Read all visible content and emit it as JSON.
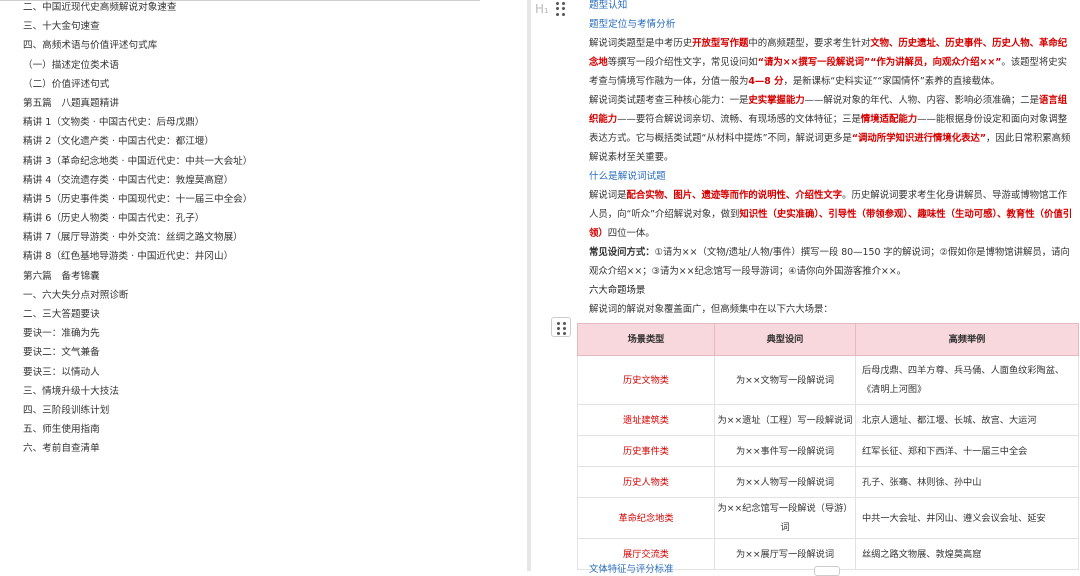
{
  "toc": [
    "二、中国近现代史高频解说对象速查",
    "三、十大金句速查",
    "四、高频术语与价值评述句式库",
    "（一）描述定位类术语",
    "（二）价值评述句式",
    "第五篇　八题真题精讲",
    "精讲 1（文物类 · 中国古代史：后母戊鼎）",
    "精讲 2（文化遗产类 · 中国古代史：都江堰）",
    "精讲 3（革命纪念地类 · 中国近代史：中共一大会址）",
    "精讲 4（交流遗存类 · 中国古代史：敦煌莫高窟）",
    "精讲 5（历史事件类 · 中国现代史：十一届三中全会）",
    "精讲 6（历史人物类 · 中国古代史：孔子）",
    "精讲 7（展厅导游类 · 中外交流：丝绸之路文物展）",
    "精讲 8（红色基地导游类 · 中国近代史：井冈山）",
    "第六篇　备考锦囊",
    "一、六大失分点对照诊断",
    "二、三大答题要诀",
    "要诀一：准确为先",
    "要诀二：文气兼备",
    "要诀三：以情动人",
    "三、情境升级十大技法",
    "四、三阶段训练计划",
    "五、师生使用指南",
    "六、考前自查清单"
  ],
  "doc": {
    "h1": "题型认知",
    "h2": "题型定位与考情分析",
    "p1": {
      "a": "解说词类题型是中考历史",
      "b": "开放型写作题",
      "c": "中的高频题型，要求考生针对",
      "d": "文物、历史遗址、历史事件、历史人物、革命纪念地",
      "e": "等撰写一段介绍性文字，常见设问如",
      "f": "“请为××撰写一段解说词”“作为讲解员，向观众介绍××”",
      "g": "。该题型将史实考查与情境写作融为一体，分值一般为",
      "h": "4—8 分",
      "i": "，是新课标“史料实证”“家国情怀”素养的直接载体。"
    },
    "p2": {
      "a": "解说词类试题考查三种核心能力：一是",
      "b": "史实掌握能力",
      "c": "——解说对象的年代、人物、内容、影响必须准确；二是",
      "d": "语言组织能力",
      "e": "——要符合解说词亲切、流畅、有现场感的文体特征；三是",
      "f": "情境适配能力",
      "g": "——能根据身份设定和面向对象调整表达方式。它与概括类试题“从材料中提炼”不同，解说词更多是",
      "h": "“调动所学知识进行情境化表达”",
      "i": "，因此日常积累高频解说素材至关重要。"
    },
    "h3": "什么是解说词试题",
    "p3": {
      "a": "解说词是",
      "b": "配合实物、图片、遗迹等而作的说明性、介绍性文字",
      "c": "。历史解说词要求考生化身讲解员、导游或博物馆工作人员，向“听众”介绍解说对象，做到",
      "d": "知识性（史实准确）、引导性（带领参观）、趣味性（生动可感）、教育性（价值引领）",
      "e": "四位一体。"
    },
    "p4": {
      "a": "常见设问方式：",
      "b": "①请为××（文物/遗址/人物/事件）撰写一段 80—150 字的解说词；②假如你是博物馆讲解员，请向观众介绍××；③请为××纪念馆写一段导游词；④请你向外国游客推介××。"
    },
    "h4": "六大命题场景",
    "p5": "解说词的解说对象覆盖面广，但高频集中在以下六大场景：",
    "table": {
      "headers": [
        "场景类型",
        "典型设问",
        "高频举例"
      ],
      "rows": [
        [
          "历史文物类",
          "为××文物写一段解说词",
          "后母戊鼎、四羊方尊、兵马俑、人面鱼纹彩陶盆、《清明上河图》"
        ],
        [
          "遗址建筑类",
          "为××遗址（工程）写一段解说词",
          "北京人遗址、都江堰、长城、故宫、大运河"
        ],
        [
          "历史事件类",
          "为××事件写一段解说词",
          "红军长征、郑和下西洋、十一届三中全会"
        ],
        [
          "历史人物类",
          "为××人物写一段解说词",
          "孔子、张骞、林则徐、孙中山"
        ],
        [
          "革命纪念地类",
          "为××纪念馆写一段解说（导游）词",
          "中共一大会址、井冈山、遵义会议会址、延安"
        ],
        [
          "展厅交流类",
          "为××展厅写一段解说词",
          "丝绸之路文物展、敦煌莫高窟"
        ]
      ]
    },
    "h5": "文体特征与评分标准"
  }
}
